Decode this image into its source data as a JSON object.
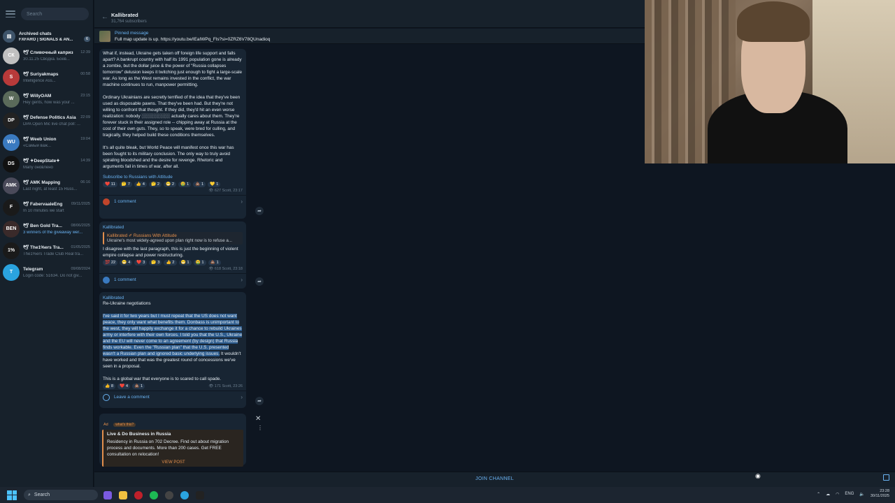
{
  "sidebar": {
    "search_placeholder": "Search",
    "archived": {
      "name": "Archived chats",
      "preview": "FXFARO | SIGNALS & AN...",
      "badge": "6"
    },
    "chats": [
      {
        "name": "🕊 Сливочный каприз",
        "time": "12:39",
        "preview": "30.11.25 Сводка. Боев...",
        "avatar": "СК",
        "color": "#c0c0c0"
      },
      {
        "name": "🕊 Suriyakmaps",
        "time": "00:58",
        "preview": "Intelligence Ass...",
        "avatar": "S",
        "color": "#b83a3a"
      },
      {
        "name": "🕊 WillyOAM",
        "time": "23:15",
        "preview": "Hey gents, how was your ...",
        "avatar": "W",
        "color": "#5a6a5a"
      },
      {
        "name": "🕊 Defense Politics Asia",
        "time": "22:09",
        "preview": "DPA Open Mic live chat poll: ...",
        "avatar": "DP",
        "color": "#222222"
      },
      {
        "name": "🕊 Weeb Union",
        "time": "19:04",
        "preview": "«Самый важ...",
        "avatar": "WU",
        "color": "#3a7ac0"
      },
      {
        "name": "🕊 ✦DeepState✦",
        "time": "14:39",
        "preview": "Мапу оновлено",
        "avatar": "DS",
        "color": "#111111"
      },
      {
        "name": "🕊 AMK Mapping",
        "time": "06:16",
        "preview": "Last night, at least 15 Russ...",
        "avatar": "AMK",
        "color": "#4a4a5a"
      },
      {
        "name": "🕊 FabervaaleEng",
        "time": "09/11/2025",
        "preview": "In 10 minutes we start",
        "avatar": "F",
        "color": "#1a1a1a"
      },
      {
        "name": "🕊 Ben Gold Tra...",
        "time": "08/06/2025",
        "preview": "3 winners of the giveaway wer...",
        "avatar": "BEN",
        "color": "#3a2a2a"
      },
      {
        "name": "🕊 The1%ers Tra...",
        "time": "01/05/2025",
        "preview": "The1%ers Trade Club Real tra...",
        "avatar": "1%",
        "color": "#1a1a1a"
      },
      {
        "name": "Telegram",
        "time": "09/08/2024",
        "preview": "Login code: 51634. Do not giv...",
        "avatar": "T",
        "color": "#2aa3df"
      }
    ]
  },
  "header": {
    "title": "Kallibrated",
    "subscribers": "31,764 subscribers"
  },
  "pinned": {
    "title": "Pinned message",
    "text": "Full map update is up. https://youtu.be/lEaIWPq_Fls?si=0ZRZ6V78QUnadioq"
  },
  "message1": {
    "paragraphs": [
      "What if, instead, Ukraine gets taken off foreign life support and falls apart? A bankrupt country with half its 1991 population gone is already a zombie, but the dollar juice & the power of \"Russia collapses tomorrow\" delusion keeps it twitching just enough to fight a large-scale war. As long as the West remains invested in the conflict, the war machine continues to run, manpower permitting.",
      "Ordinary Ukrainians are secretly terrified of the idea that they've been used as disposable pawns. That they've been had. But they're not willing to confront that thought. If they did, they'd hit an even worse realization: nobody ░░░░░░░░░ actually cares about them. They're forever stuck in their assigned role -- chipping away at Russia at the cost of their own guts. They, so to speak, were bred for culling, and tragically, they helped build these conditions themselves.",
      "It's all quite bleak, but World Peace will manifest once this war has been fought to its military conclusion. The only way to truly avoid spiraling bloodshed and the desire for revenge. Rhetoric and arguments fail in times of war, after all."
    ],
    "link": "Subscribe to Russians with Attitude",
    "reactions": [
      "❤️ 11",
      "🤔 7",
      "👍 4",
      "🤔 2",
      "😁 2",
      "🤮 1",
      "💩 1",
      "💛 1"
    ],
    "meta": "👁 627  Scott, 23:17",
    "comments": "1 comment"
  },
  "message2": {
    "author": "Kallibrated",
    "quote_author": "Kallibrated ✐ Russians With Attitude",
    "quote_text": "Ukraine's most widely-agreed upon plan right now is to refuse a...",
    "text": "I disagree with the last paragraph, this is just the beginning of violent empire collapse and power restructuring.",
    "reactions": [
      "💯 22",
      "😁 4",
      "❤️ 3",
      "🤔 3",
      "👍 2",
      "😁 1",
      "🤮 1",
      "💩 1"
    ],
    "meta": "👁 618  Scott, 23:18",
    "comments": "1 comment"
  },
  "message3": {
    "author": "Kallibrated",
    "subtitle": "Re-Ukraine negotiations",
    "selected_text": "I've said it for two years but I must repeat that the US does not want peace, they only want what benefits them. Donbass is unimportant to the west, they will happily exchange it for a chance to rebuild Ukraines army or interfere with their own forces. I told you that the U.S., Ukraine and the EU will never come to an agreement (by design) that Russia finds workable. Even the \"Russian plan\" that the U.S. presented wasn't a Russian plan and ignored basic underlying issues.",
    "rest_text": "It wouldn't have worked and that was the greatest round of concessions we've seen in a proposal.",
    "final_text": "This is a global war that everyone is to scared to call spade.",
    "reactions": [
      "👍 8",
      "❤️ 4",
      "💩 1"
    ],
    "meta": "👁 171  Scott, 23:26",
    "comments": "Leave a comment"
  },
  "ad": {
    "label": "Ad",
    "pill": "what's this?",
    "title": "Live & Do Business in Russia",
    "body": "Residency in Russia on 702 Decree. Find out about migration process and documents. More than 200 cases. Get FREE consultation on relocation!",
    "button": "VIEW POST"
  },
  "join": "JOIN CHANNEL",
  "taskbar": {
    "search": "Search",
    "lang": "ENG",
    "time": "23:28",
    "date": "30/11/2025"
  },
  "colors": {
    "background": "#0e1621",
    "panel": "#17212b",
    "bubble": "#182533",
    "accent": "#6ab3f3",
    "selection": "#2b5a8c",
    "ad_accent": "#e38f4c"
  }
}
